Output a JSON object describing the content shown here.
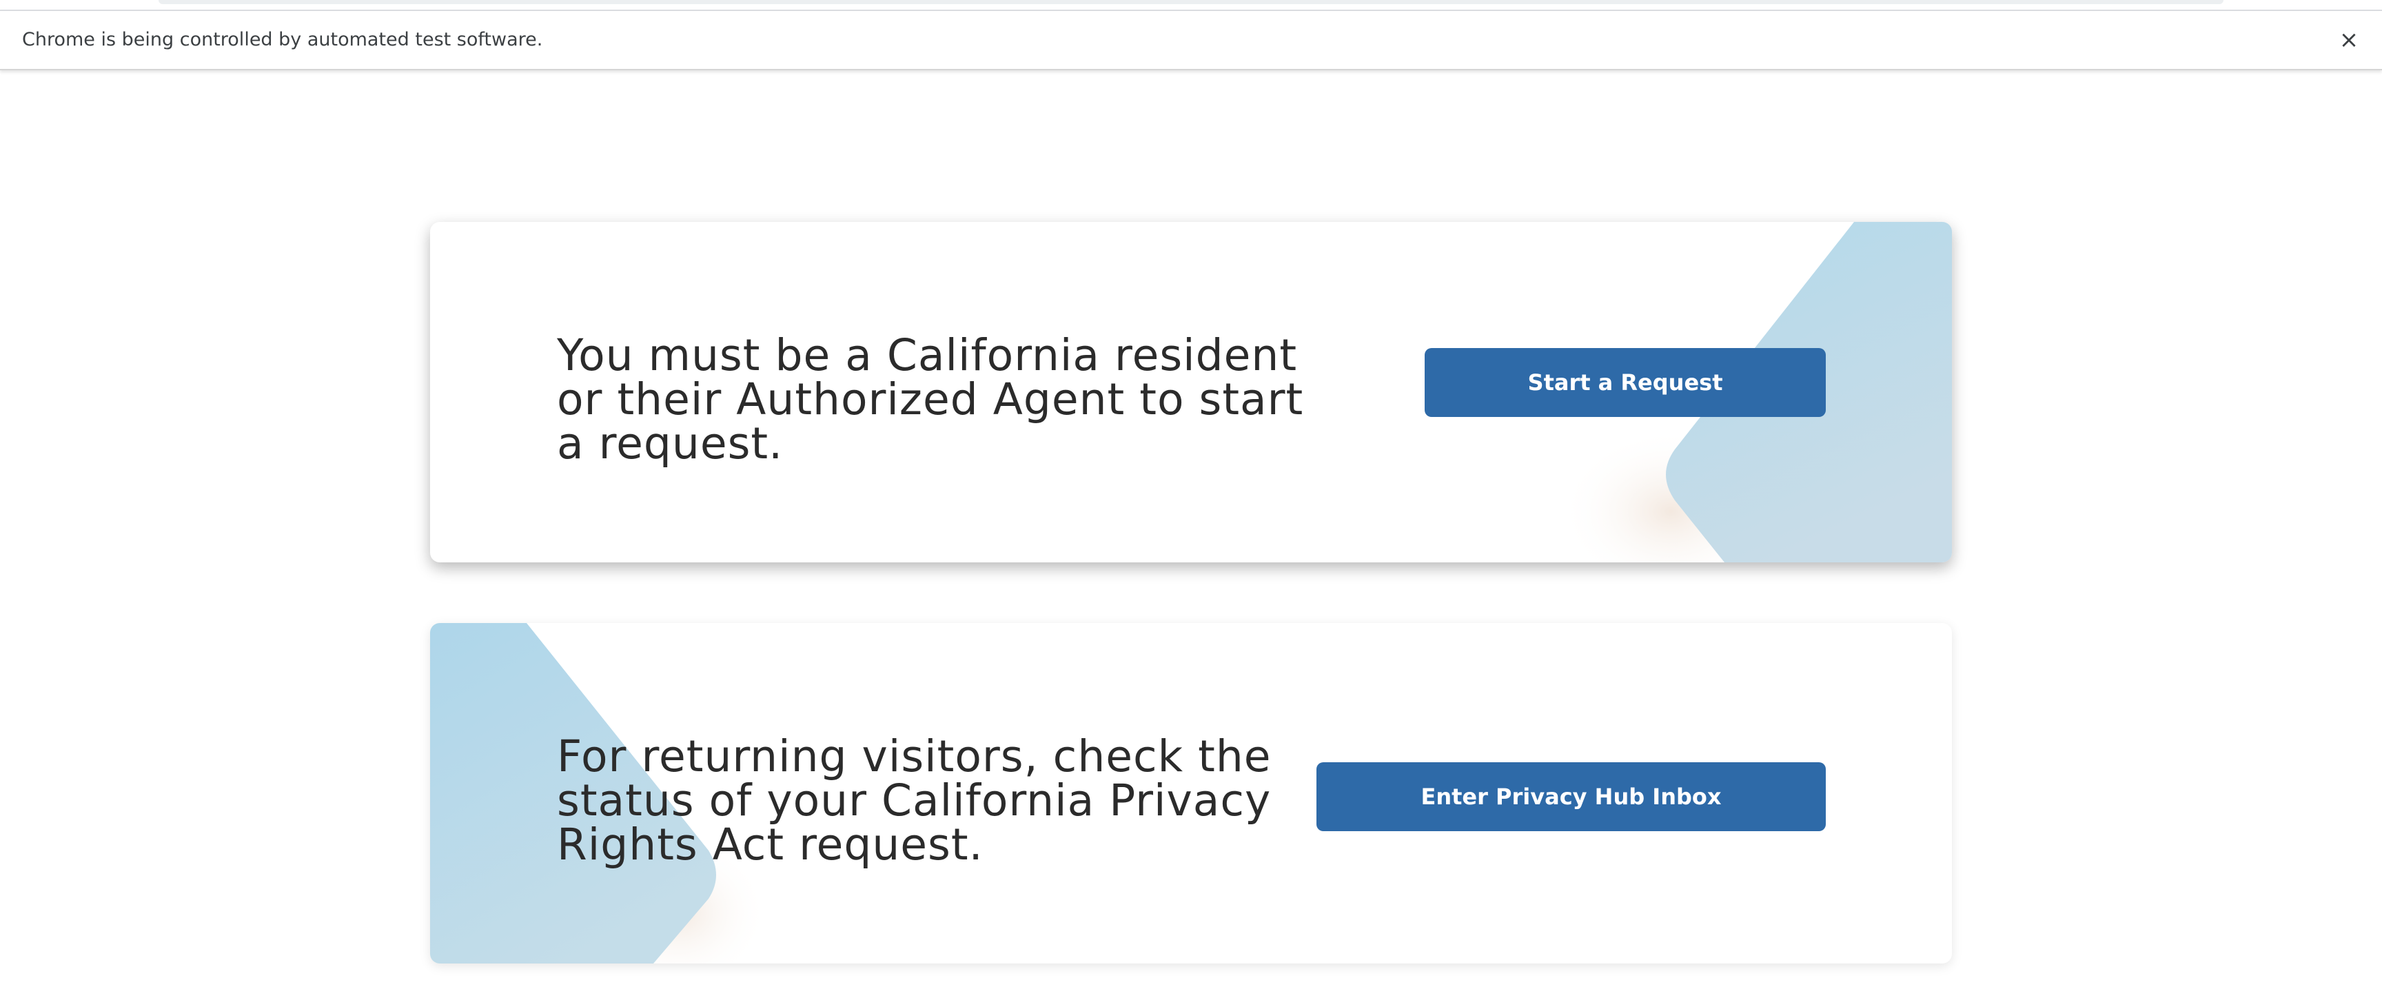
{
  "browser": {
    "infobar_message": "Chrome is being controlled by automated test software.",
    "infobar_close_icon": "×"
  },
  "colors": {
    "button_bg": "#2e6aa8",
    "button_text": "#ffffff",
    "accent_light_blue": "#b3d9ea",
    "heading_text": "#2b2b2b"
  },
  "cards": [
    {
      "text": "You must be a California resident or their Authorized Agent to start a request.",
      "button_label": "Start a Request"
    },
    {
      "text": "For returning visitors, check the status of your California Privacy Rights Act request.",
      "button_label": "Enter Privacy Hub Inbox"
    }
  ]
}
